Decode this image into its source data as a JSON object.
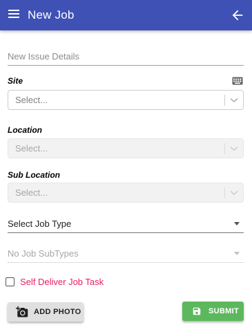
{
  "header": {
    "title": "New Job",
    "menu_icon": "hamburger-menu-icon",
    "back_icon": "arrow-left-icon",
    "background": "#3f51b5"
  },
  "form": {
    "issue_details_placeholder": "New Issue Details",
    "site": {
      "label": "Site",
      "placeholder": "Select...",
      "keyboard_icon": "keyboard-icon"
    },
    "location": {
      "label": "Location",
      "placeholder": "Select..."
    },
    "sub_location": {
      "label": "Sub Location",
      "placeholder": "Select..."
    },
    "job_type": {
      "placeholder": "Select Job Type"
    },
    "job_subtype": {
      "placeholder": "No Job SubTypes"
    },
    "self_deliver": {
      "label": "Self Deliver Job Task",
      "checked": false,
      "color": "#e91e63"
    }
  },
  "actions": {
    "add_photo": {
      "label": "ADD PHOTO",
      "icon": "add-photo-camera-icon"
    },
    "submit": {
      "label": "SUBMIT",
      "icon": "save-floppy-icon",
      "color": "#5cb85c"
    }
  }
}
